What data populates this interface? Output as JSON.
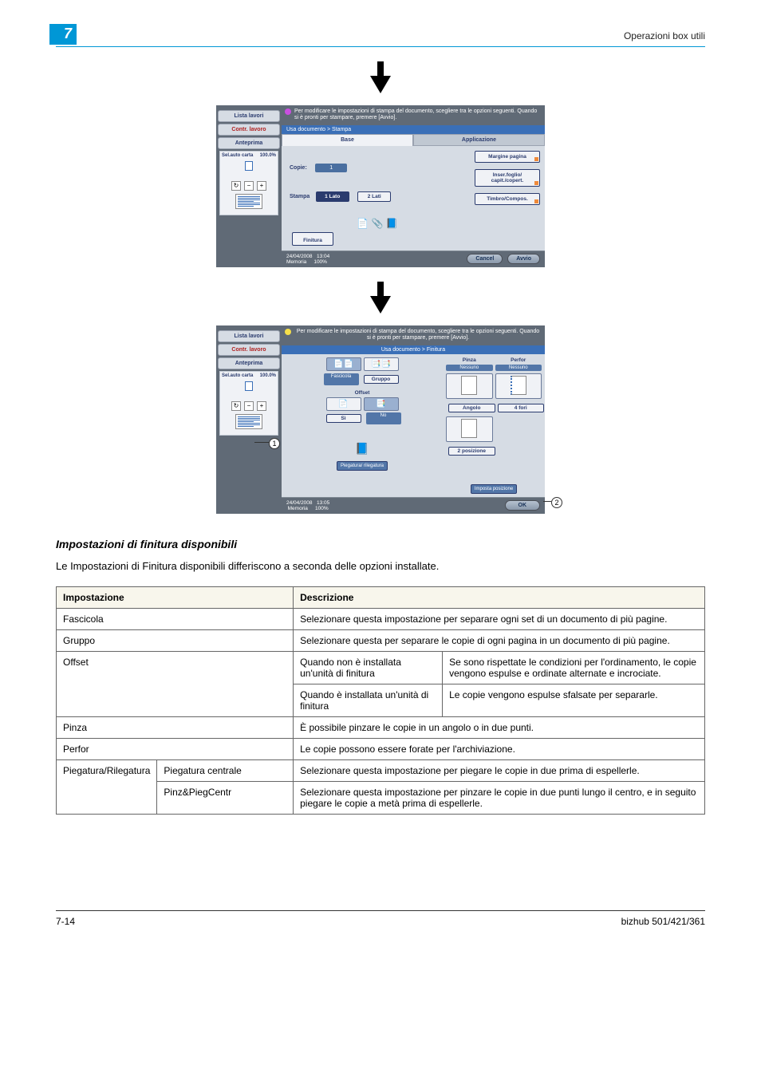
{
  "header": {
    "chapter": "7",
    "right_title": "Operazioni box utili"
  },
  "panel1": {
    "left": {
      "lista_lavori": "Lista lavori",
      "contr": "Contr. lavoro",
      "anteprima": "Anteprima",
      "sel_auto": "Sel.auto carta",
      "pct": "100.0%"
    },
    "instr": "Per modificare le impostazioni di stampa del documento, scegliere tra le opzioni seguenti. Quando si è pronti per stampare, premere [Avvio].",
    "breadcrumb": "Usa documento > Stampa",
    "tabs": {
      "base": "Base",
      "app": "Applicazione"
    },
    "fields": {
      "copie_l": "Copie:",
      "copie_v": "1",
      "stampa_l": "Stampa",
      "lato1": "1 Lato",
      "lato2": "2 Lati",
      "margine": "Margine pagina",
      "inser": "Inser.foglio/ capit./copert.",
      "timbro": "Timbro/Compos."
    },
    "finitura": "Finitura",
    "status": {
      "date": "24/04/2008",
      "time": "13:04",
      "mem_l": "Memoria",
      "mem_v": "100%",
      "cancel": "Cancel",
      "avvio": "Avvio"
    }
  },
  "panel2": {
    "breadcrumb": "Usa documento > Finitura",
    "fascicola": "Fascicola",
    "gruppo": "Gruppo",
    "offset": "Offset",
    "si": "Sì",
    "no": "No",
    "pinza": "Pinza",
    "perfor": "Perfor",
    "nessuno": "Nessuno",
    "angolo": "Angolo",
    "fori4": "4 fori",
    "pos2": "2 posizione",
    "piegatura": "Piegatura/ rilegatura",
    "imposta": "Imposta posizione",
    "ok": "OK",
    "status": {
      "date": "24/04/2008",
      "time": "13:05",
      "mem_l": "Memoria",
      "mem_v": "100%"
    },
    "callout1": "1",
    "callout2": "2"
  },
  "section_title": "Impostazioni di finitura disponibili",
  "section_body": "Le Impostazioni di Finitura disponibili differiscono a seconda delle opzioni installate.",
  "table": {
    "h1": "Impostazione",
    "h2": "Descrizione",
    "rows": [
      {
        "c1": "Fascicola",
        "c2": "Selezionare questa impostazione per separare ogni set di un documento di più pagine."
      },
      {
        "c1": "Gruppo",
        "c2": "Selezionare questa per separare le copie di ogni pagina in un documento di più pagine."
      }
    ],
    "offset": {
      "c1": "Offset",
      "sub": [
        {
          "a": "Quando non è installata un'unità di finitura",
          "b": "Se sono rispettate le condizioni per l'ordinamento, le copie vengono espulse e ordinate alternate e incrociate."
        },
        {
          "a": "Quando è installata un'unità di finitura",
          "b": "Le copie vengono espulse sfalsate per separarle."
        }
      ]
    },
    "pinza": {
      "c1": "Pinza",
      "c2": "È possibile pinzare le copie in un angolo o in due punti."
    },
    "perfor": {
      "c1": "Perfor",
      "c2": "Le copie possono essere forate per l'archiviazione."
    },
    "pieg": {
      "c1": "Piegatura/Rilegatura",
      "sub": [
        {
          "a": "Piegatura centrale",
          "b": "Selezionare questa impostazione per piegare le copie in due prima di espellerle."
        },
        {
          "a": "Pinz&PiegCentr",
          "b": "Selezionare questa impostazione per pinzare le copie in due punti lungo il centro, e in seguito piegare le copie a metà prima di espellerle."
        }
      ]
    }
  },
  "footer": {
    "left": "7-14",
    "right": "bizhub 501/421/361"
  }
}
